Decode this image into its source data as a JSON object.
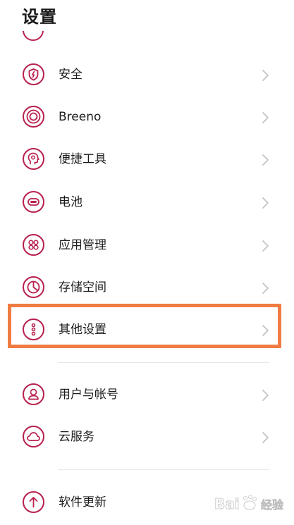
{
  "page": {
    "title": "设置"
  },
  "colors": {
    "icon": "#b8214d",
    "chevron": "#c4c4c4",
    "highlight": "#f07c43",
    "divider": "#e8e8e8"
  },
  "settings": {
    "items": [
      {
        "label": "安全",
        "icon": "shield-bolt-icon"
      },
      {
        "label": "Breeno",
        "icon": "breeno-icon"
      },
      {
        "label": "便捷工具",
        "icon": "convenience-tool-icon"
      },
      {
        "label": "电池",
        "icon": "battery-icon"
      },
      {
        "label": "应用管理",
        "icon": "app-grid-icon"
      },
      {
        "label": "存储空间",
        "icon": "storage-pie-icon"
      },
      {
        "label": "其他设置",
        "icon": "more-dots-icon"
      },
      {
        "label": "用户与帐号",
        "icon": "user-icon"
      },
      {
        "label": "云服务",
        "icon": "cloud-icon"
      },
      {
        "label": "软件更新",
        "icon": "arrow-up-icon"
      }
    ]
  },
  "watermark": {
    "text": "Bai经验"
  }
}
